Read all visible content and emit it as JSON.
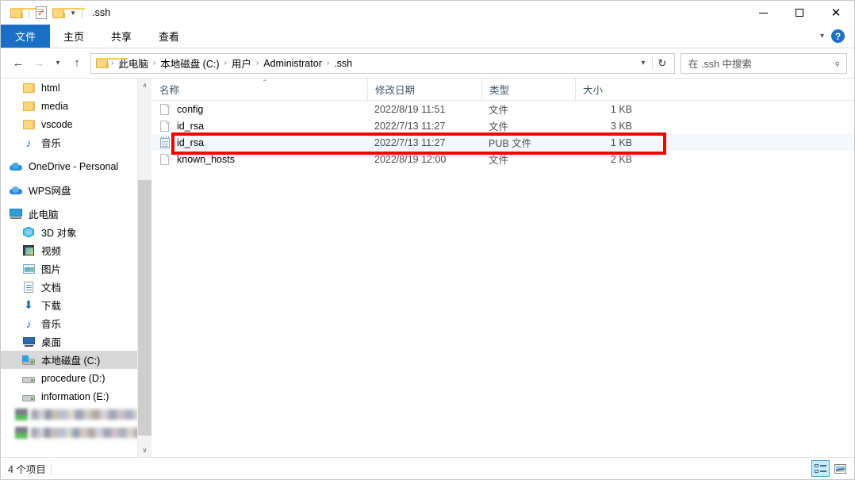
{
  "window": {
    "title": ".ssh",
    "quick_access": [
      {
        "name": "folder-icon",
        "label": ""
      },
      {
        "name": "properties-check-icon",
        "label": ""
      },
      {
        "name": "new-folder-icon",
        "label": ""
      },
      {
        "name": "customize-quick-access-chevron-icon",
        "label": "⌄"
      }
    ],
    "controls": {
      "minimize": "—",
      "maximize": "□",
      "close": "✕"
    }
  },
  "ribbon": {
    "tabs": [
      {
        "label": "文件",
        "active": true
      },
      {
        "label": "主页",
        "active": false
      },
      {
        "label": "共享",
        "active": false
      },
      {
        "label": "查看",
        "active": false
      }
    ],
    "expand_icon": "⌄",
    "help_icon": "?",
    "accent_color": "#1a6fc4"
  },
  "nav": {
    "back": "←",
    "forward": "→",
    "recent": "⌄",
    "up": "↑",
    "breadcrumbs": [
      "此电脑",
      "本地磁盘 (C:)",
      "用户",
      "Administrator",
      ".ssh"
    ],
    "crumb_separator": "›",
    "address_chevron": "⌄",
    "refresh_icon": "↻",
    "search_placeholder": "在 .ssh 中搜索",
    "search_value": "",
    "search_icon": "⚲"
  },
  "sidebar": {
    "items": [
      {
        "label": "html",
        "icon": "folder-icon",
        "depth": 1,
        "selected": false,
        "blurred": false
      },
      {
        "label": "media",
        "icon": "folder-icon",
        "depth": 1,
        "selected": false,
        "blurred": false
      },
      {
        "label": "vscode",
        "icon": "folder-icon",
        "depth": 1,
        "selected": false,
        "blurred": false
      },
      {
        "label": "音乐",
        "icon": "music-icon",
        "depth": 1,
        "selected": false,
        "blurred": false
      },
      {
        "label": "OneDrive - Personal",
        "icon": "onedrive-cloud-icon",
        "depth": 0,
        "selected": false,
        "blurred": false
      },
      {
        "label": "WPS网盘",
        "icon": "wps-cloud-icon",
        "depth": 0,
        "selected": false,
        "blurred": false
      },
      {
        "label": "此电脑",
        "icon": "this-pc-icon",
        "depth": 0,
        "selected": false,
        "blurred": false
      },
      {
        "label": "3D 对象",
        "icon": "3d-objects-icon",
        "depth": 1,
        "selected": false,
        "blurred": false
      },
      {
        "label": "视频",
        "icon": "videos-icon",
        "depth": 1,
        "selected": false,
        "blurred": false
      },
      {
        "label": "图片",
        "icon": "pictures-icon",
        "depth": 1,
        "selected": false,
        "blurred": false
      },
      {
        "label": "文档",
        "icon": "documents-icon",
        "depth": 1,
        "selected": false,
        "blurred": false
      },
      {
        "label": "下载",
        "icon": "downloads-icon",
        "depth": 1,
        "selected": false,
        "blurred": false
      },
      {
        "label": "音乐",
        "icon": "music-icon",
        "depth": 1,
        "selected": false,
        "blurred": false
      },
      {
        "label": "桌面",
        "icon": "desktop-icon",
        "depth": 1,
        "selected": false,
        "blurred": false
      },
      {
        "label": "本地磁盘 (C:)",
        "icon": "system-drive-icon",
        "depth": 1,
        "selected": true,
        "blurred": false
      },
      {
        "label": "procedure (D:)",
        "icon": "drive-icon",
        "depth": 1,
        "selected": false,
        "blurred": false
      },
      {
        "label": "information (E:)",
        "icon": "drive-icon",
        "depth": 1,
        "selected": false,
        "blurred": false
      },
      {
        "label": "",
        "icon": "drive-icon",
        "depth": 1,
        "selected": false,
        "blurred": true
      },
      {
        "label": "",
        "icon": "drive-icon",
        "depth": 1,
        "selected": false,
        "blurred": true
      }
    ],
    "scroll_up_icon": "∧",
    "scroll_down_icon": "∨"
  },
  "filelist": {
    "columns": [
      {
        "key": "name",
        "label": "名称",
        "sorted": true,
        "sort_caret": "⌃"
      },
      {
        "key": "date",
        "label": "修改日期",
        "sorted": false
      },
      {
        "key": "type",
        "label": "类型",
        "sorted": false
      },
      {
        "key": "size",
        "label": "大小",
        "sorted": false
      }
    ],
    "rows": [
      {
        "name": "config",
        "date": "2022/8/19 11:51",
        "type": "文件",
        "size": "1 KB",
        "icon": "blank-file-icon",
        "selected": false
      },
      {
        "name": "id_rsa",
        "date": "2022/7/13 11:27",
        "type": "文件",
        "size": "3 KB",
        "icon": "blank-file-icon",
        "selected": false
      },
      {
        "name": "id_rsa",
        "date": "2022/7/13 11:27",
        "type": "PUB 文件",
        "size": "1 KB",
        "icon": "notepad-file-icon",
        "selected": true
      },
      {
        "name": "known_hosts",
        "date": "2022/8/19 12:00",
        "type": "文件",
        "size": "2 KB",
        "icon": "blank-file-icon",
        "selected": false
      }
    ],
    "annotation": {
      "color": "#f40000",
      "target_row_index": 2
    }
  },
  "statusbar": {
    "item_count": "4 个项目",
    "views": [
      {
        "name": "details-view",
        "active": true
      },
      {
        "name": "large-icons-view",
        "active": false
      }
    ]
  }
}
